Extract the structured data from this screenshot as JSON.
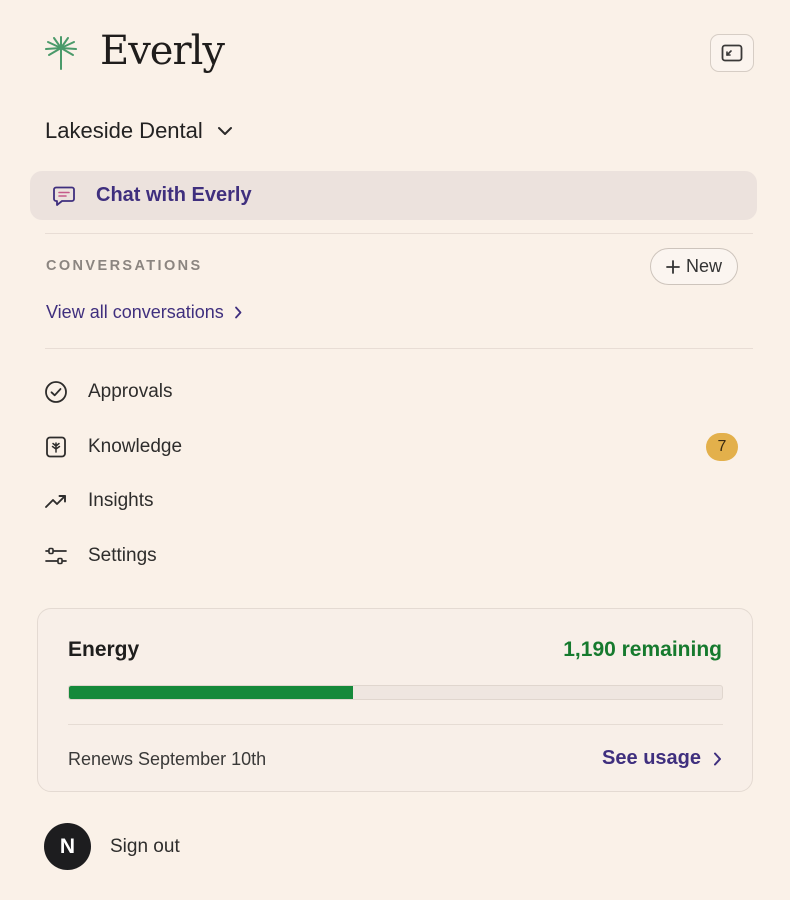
{
  "app": {
    "brand": "Everly",
    "icons": {
      "logo": "palm-tree-icon",
      "collapse": "sidebar-collapse-icon"
    }
  },
  "org": {
    "name": "Lakeside Dental",
    "icon": "chevron-down-icon"
  },
  "chat": {
    "label": "Chat with Everly",
    "icon": "chat-bubble-icon"
  },
  "conversations": {
    "section_label": "CONVERSATIONS",
    "new_label": "New",
    "view_all_label": "View all conversations"
  },
  "nav": {
    "items": [
      {
        "label": "Approvals",
        "icon": "check-circle-icon"
      },
      {
        "label": "Knowledge",
        "icon": "knowledge-book-icon",
        "badge": "7"
      },
      {
        "label": "Insights",
        "icon": "trending-up-icon"
      },
      {
        "label": "Settings",
        "icon": "sliders-icon"
      }
    ]
  },
  "energy": {
    "title": "Energy",
    "remaining": "1,190 remaining",
    "used_fraction": 0.435,
    "renews": "Renews September 10th",
    "see_usage_label": "See usage"
  },
  "user": {
    "initial": "N",
    "signout_label": "Sign out"
  },
  "colors": {
    "background": "#faf1e8",
    "accent": "#3f2f7e",
    "energy_green": "#15893a",
    "badge": "#e3b04b"
  }
}
